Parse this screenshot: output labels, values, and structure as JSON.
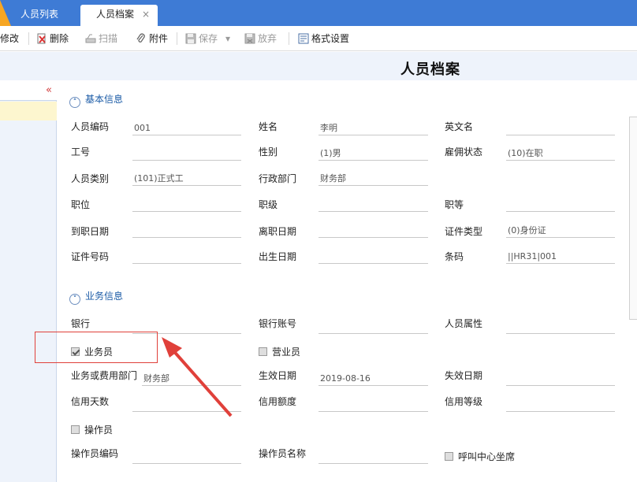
{
  "tabs": {
    "items": [
      {
        "label": "人员列表"
      },
      {
        "label": "人员档案"
      }
    ],
    "close_glyph": "×"
  },
  "toolbar": {
    "edit_label": "修改",
    "delete_label": "删除",
    "scan_label": "扫描",
    "attach_label": "附件",
    "save_label": "保存",
    "discard_label": "放弃",
    "format_label": "格式设置"
  },
  "page": {
    "title": "人员档案"
  },
  "leftpane": {
    "collapse_glyph": "«"
  },
  "sections": {
    "basic": {
      "title": "基本信息",
      "toggle": "˄"
    },
    "business": {
      "title": "业务信息",
      "toggle": "˅"
    }
  },
  "basic": {
    "emp_code": {
      "label": "人员编码",
      "value": "001"
    },
    "name": {
      "label": "姓名",
      "value": "李明"
    },
    "eng_name": {
      "label": "英文名",
      "value": ""
    },
    "job_no": {
      "label": "工号",
      "value": ""
    },
    "gender": {
      "label": "性别",
      "value": "(1)男"
    },
    "emp_status": {
      "label": "雇佣状态",
      "value": "(10)在职"
    },
    "emp_type": {
      "label": "人员类别",
      "value": "(101)正式工"
    },
    "dept": {
      "label": "行政部门",
      "value": "财务部"
    },
    "position": {
      "label": "职位",
      "value": ""
    },
    "rank": {
      "label": "职级",
      "value": ""
    },
    "grade": {
      "label": "职等",
      "value": ""
    },
    "hire_date": {
      "label": "到职日期",
      "value": ""
    },
    "leave_date": {
      "label": "离职日期",
      "value": ""
    },
    "id_type": {
      "label": "证件类型",
      "value": "(0)身份证"
    },
    "id_no": {
      "label": "证件号码",
      "value": ""
    },
    "birth_date": {
      "label": "出生日期",
      "value": ""
    },
    "barcode": {
      "label": "条码",
      "value": "||HR31|001"
    }
  },
  "business": {
    "bank": {
      "label": "银行",
      "value": ""
    },
    "bank_account": {
      "label": "银行账号",
      "value": ""
    },
    "attribute": {
      "label": "人员属性",
      "value": ""
    },
    "salesman": {
      "label": "业务员",
      "checked": true
    },
    "clerk": {
      "label": "营业员",
      "checked": false
    },
    "cost_dept": {
      "label": "业务或费用部门",
      "value": "财务部"
    },
    "effective_date": {
      "label": "生效日期",
      "value": "2019-08-16"
    },
    "expire_date": {
      "label": "失效日期",
      "value": ""
    },
    "credit_days": {
      "label": "信用天数",
      "value": ""
    },
    "credit_limit": {
      "label": "信用额度",
      "value": ""
    },
    "credit_level": {
      "label": "信用等级",
      "value": ""
    },
    "operator": {
      "label": "操作员",
      "checked": false
    },
    "operator_code": {
      "label": "操作员编码",
      "value": ""
    },
    "operator_name": {
      "label": "操作员名称",
      "value": ""
    },
    "call_center": {
      "label": "呼叫中心坐席",
      "checked": false
    }
  },
  "colors": {
    "tabbar": "#3e7bd5",
    "accent": "#f6a623",
    "section_title": "#1b5ba6",
    "highlight": "#e0403a"
  },
  "icons": {
    "delete": "delete-icon",
    "scan": "scan-icon",
    "attach": "paperclip-icon",
    "save": "floppy-icon",
    "discard": "discard-icon",
    "format": "format-settings-icon"
  }
}
